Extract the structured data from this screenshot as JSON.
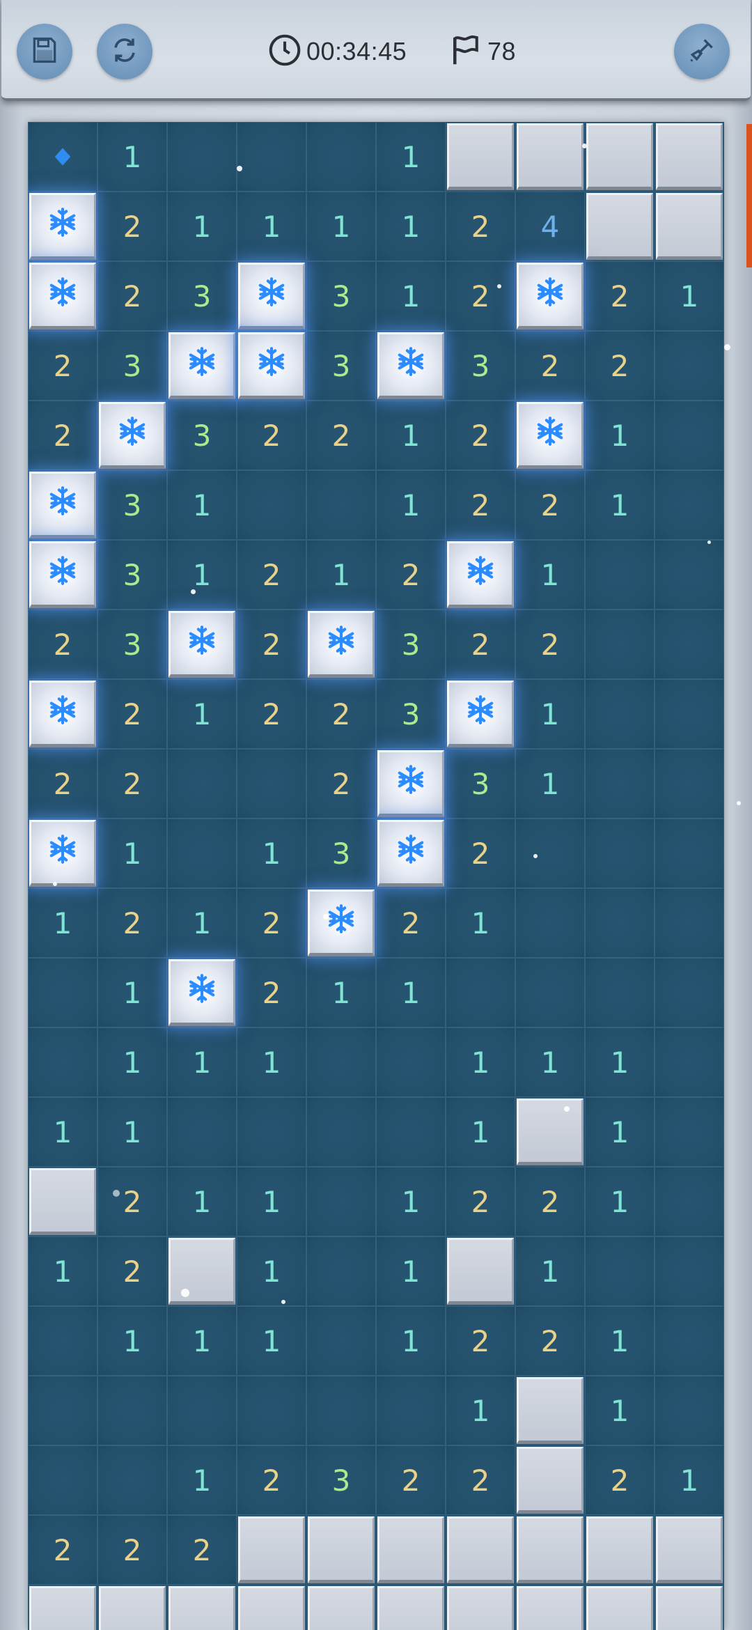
{
  "toolbar": {
    "timer": "00:34:45",
    "flags": "78",
    "icons": {
      "save": "save-disk-icon",
      "restart": "refresh-icon",
      "timer": "clock-icon",
      "flags": "flag-icon",
      "mode": "shovel-icon"
    }
  },
  "board": {
    "columns": 10,
    "legend": {
      "D": "diamond-marker",
      "H": "hidden",
      "M": "mine",
      ".": "empty",
      "1-4": "number"
    },
    "rows": [
      [
        "D",
        "1",
        ".",
        ".",
        ".",
        "1",
        "H",
        "H",
        "H",
        "H"
      ],
      [
        "M",
        "2",
        "1",
        "1",
        "1",
        "1",
        "2",
        "4",
        "H",
        "H"
      ],
      [
        "M",
        "2",
        "3",
        "M",
        "3",
        "1",
        "2",
        "M",
        "2",
        "1"
      ],
      [
        "2",
        "3",
        "M",
        "M",
        "3",
        "M",
        "3",
        "2",
        "2",
        "."
      ],
      [
        "2",
        "M",
        "3",
        "2",
        "2",
        "1",
        "2",
        "M",
        "1",
        "."
      ],
      [
        "M",
        "3",
        "1",
        ".",
        ".",
        "1",
        "2",
        "2",
        "1",
        "."
      ],
      [
        "M",
        "3",
        "1",
        "2",
        "1",
        "2",
        "M",
        "1",
        ".",
        "."
      ],
      [
        "2",
        "3",
        "M",
        "2",
        "M",
        "3",
        "2",
        "2",
        ".",
        "."
      ],
      [
        "M",
        "2",
        "1",
        "2",
        "2",
        "3",
        "M",
        "1",
        ".",
        "."
      ],
      [
        "2",
        "2",
        ".",
        ".",
        "2",
        "M",
        "3",
        "1",
        ".",
        "."
      ],
      [
        "M",
        "1",
        ".",
        "1",
        "3",
        "M",
        "2",
        ".",
        ".",
        "."
      ],
      [
        "1",
        "2",
        "1",
        "2",
        "M",
        "2",
        "1",
        ".",
        ".",
        "."
      ],
      [
        ".",
        "1",
        "M",
        "2",
        "1",
        "1",
        ".",
        ".",
        ".",
        "."
      ],
      [
        ".",
        "1",
        "1",
        "1",
        ".",
        ".",
        "1",
        "1",
        "1",
        "."
      ],
      [
        "1",
        "1",
        ".",
        ".",
        ".",
        ".",
        "1",
        "H",
        "1",
        "."
      ],
      [
        "H",
        "2",
        "1",
        "1",
        ".",
        "1",
        "2",
        "2",
        "1",
        "."
      ],
      [
        "1",
        "2",
        "H",
        "1",
        ".",
        "1",
        "H",
        "1",
        ".",
        "."
      ],
      [
        ".",
        "1",
        "1",
        "1",
        ".",
        "1",
        "2",
        "2",
        "1",
        "."
      ],
      [
        ".",
        ".",
        ".",
        ".",
        ".",
        ".",
        "1",
        "H",
        "1",
        "."
      ],
      [
        ".",
        ".",
        "1",
        "2",
        "3",
        "2",
        "2",
        "H",
        "2",
        "1"
      ],
      [
        "2",
        "2",
        "2",
        "H",
        "H",
        "H",
        "H",
        "H",
        "H",
        "H"
      ],
      [
        "H",
        "H",
        "H",
        "H",
        "H",
        "H",
        "H",
        "H",
        "H",
        "H"
      ]
    ]
  },
  "colors": {
    "board_bg": "#23506b",
    "num1": "#7fe4d4",
    "num2": "#e9d28a",
    "num3": "#a9ec8d",
    "num4": "#6fb0ea",
    "mine_glow": "#5a96ff",
    "accent_tab": "#d9531f"
  }
}
